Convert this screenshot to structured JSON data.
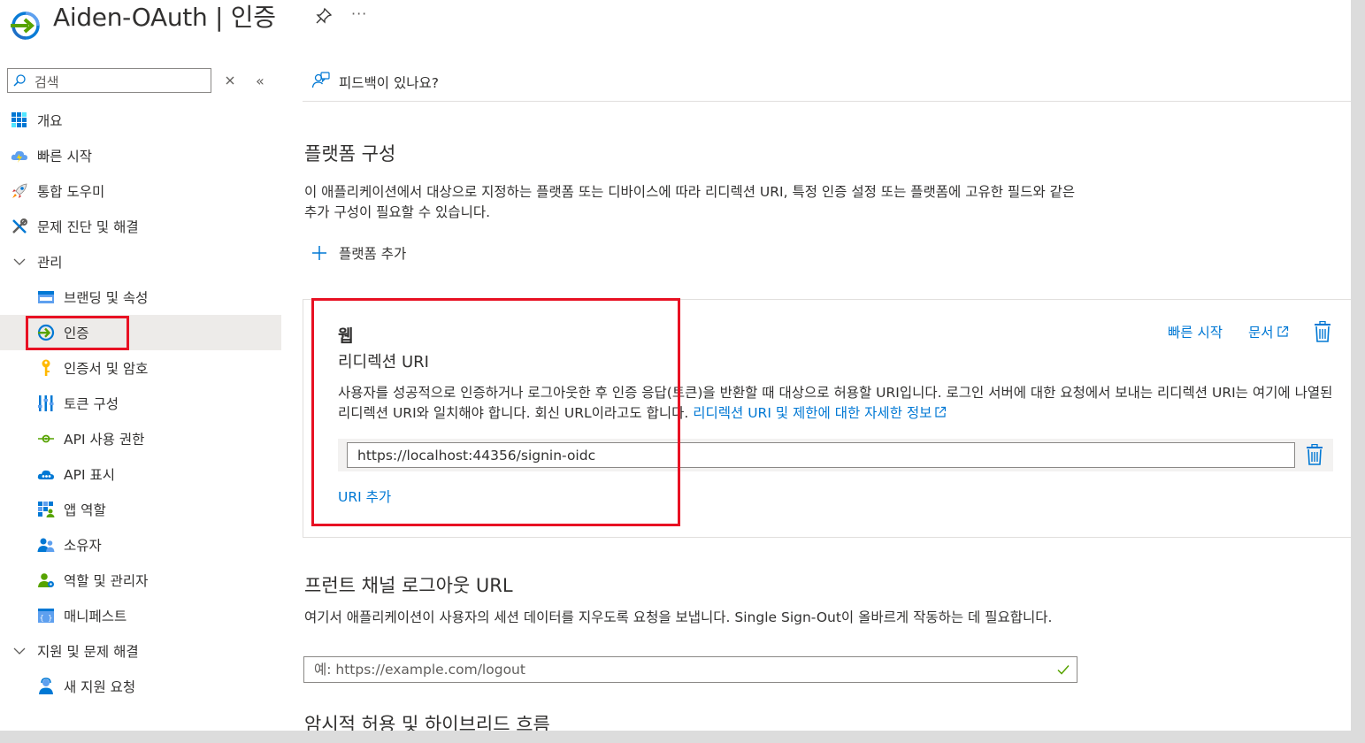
{
  "header": {
    "app_name": "Aiden-OAuth",
    "separator": "|",
    "page": "인증",
    "more": "···"
  },
  "sidebar": {
    "search_placeholder": "검색",
    "items": [
      {
        "label": "개요",
        "icon": "grid-icon"
      },
      {
        "label": "빠른 시작",
        "icon": "cloud-bolt-icon"
      },
      {
        "label": "통합 도우미",
        "icon": "rocket-icon"
      },
      {
        "label": "문제 진단 및 해결",
        "icon": "wrench-icon"
      },
      {
        "label": "관리",
        "icon": "chevron-down-icon"
      },
      {
        "label": "브랜딩 및 속성",
        "icon": "branding-icon"
      },
      {
        "label": "인증",
        "icon": "auth-arrow-icon"
      },
      {
        "label": "인증서 및 암호",
        "icon": "key-icon"
      },
      {
        "label": "토큰 구성",
        "icon": "token-bars-icon"
      },
      {
        "label": "API 사용 권한",
        "icon": "api-permission-icon"
      },
      {
        "label": "API 표시",
        "icon": "cloud-api-icon"
      },
      {
        "label": "앱 역할",
        "icon": "app-roles-icon"
      },
      {
        "label": "소유자",
        "icon": "owners-icon"
      },
      {
        "label": "역할 및 관리자",
        "icon": "roles-admin-icon"
      },
      {
        "label": "매니페스트",
        "icon": "manifest-icon"
      },
      {
        "label": "지원 및 문제 해결",
        "icon": "chevron-down-icon"
      },
      {
        "label": "새 지원 요청",
        "icon": "support-person-icon"
      }
    ]
  },
  "main": {
    "feedback": "피드백이 있나요?",
    "platform_title": "플랫폼 구성",
    "platform_desc": "이 애플리케이션에서 대상으로 지정하는 플랫폼 또는 디바이스에 따라 리디렉션 URI, 특정 인증 설정 또는 플랫폼에 고유한 필드와 같은 추가 구성이 필요할 수 있습니다.",
    "add_platform": "플랫폼 추가",
    "web": {
      "title": "웹",
      "quickstart": "빠른 시작",
      "docs": "문서",
      "redirect_title": "리디렉션 URI",
      "redirect_desc": "사용자를 성공적으로 인증하거나 로그아웃한 후 인증 응답(토큰)을 반환할 때 대상으로 허용할 URI입니다. 로그인 서버에 대한 요청에서 보내는 리디렉션 URI는 여기에 나열된 리디렉션 URI와 일치해야 합니다. 회신 URL이라고도 합니다. ",
      "redirect_link": "리디렉션 URI 및 제한에 대한 자세한 정보",
      "uri_value": "https://localhost:44356/signin-oidc",
      "add_uri": "URI 추가"
    },
    "frontchannel_title": "프런트 채널 로그아웃 URL",
    "frontchannel_desc": "여기서 애플리케이션이 사용자의 세션 데이터를 지우도록 요청을 보냅니다. Single Sign-Out이 올바르게 작동하는 데 필요합니다.",
    "logout_placeholder": "예: https://example.com/logout",
    "implicit_title": "암시적 허용 및 하이브리드 흐름"
  },
  "colors": {
    "accent": "#0078d4",
    "highlight": "#e81123",
    "selected_bg": "#edebe9"
  }
}
